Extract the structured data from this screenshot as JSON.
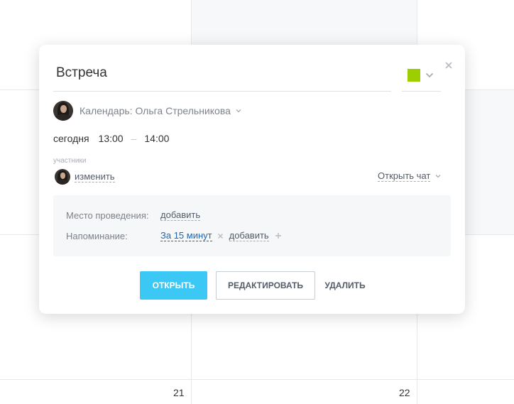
{
  "event": {
    "title": "Встреча",
    "color": "#9dcf00"
  },
  "calendar": {
    "label": "Календарь: Ольга Стрельникова"
  },
  "time": {
    "date": "сегодня",
    "start": "13:00",
    "dash": "–",
    "end": "14:00"
  },
  "participants": {
    "label": "участники",
    "change_link": "изменить",
    "open_chat": "Открыть чат"
  },
  "details": {
    "location_label": "Место проведения:",
    "location_add": "добавить",
    "reminder_label": "Напоминание:",
    "reminder_value": "За 15 минут",
    "reminder_add": "добавить"
  },
  "buttons": {
    "open": "ОТКРЫТЬ",
    "edit": "РЕДАКТИРОВАТЬ",
    "delete": "УДАЛИТЬ"
  },
  "background": {
    "day_numbers": [
      "21",
      "22"
    ]
  },
  "icons": {
    "close": "close-icon",
    "color_chevron": "chevron-down-icon",
    "calendar_chevron": "chevron-down-icon",
    "chat_chevron": "chevron-down-icon",
    "remove": "close-icon",
    "add": "plus-icon"
  }
}
